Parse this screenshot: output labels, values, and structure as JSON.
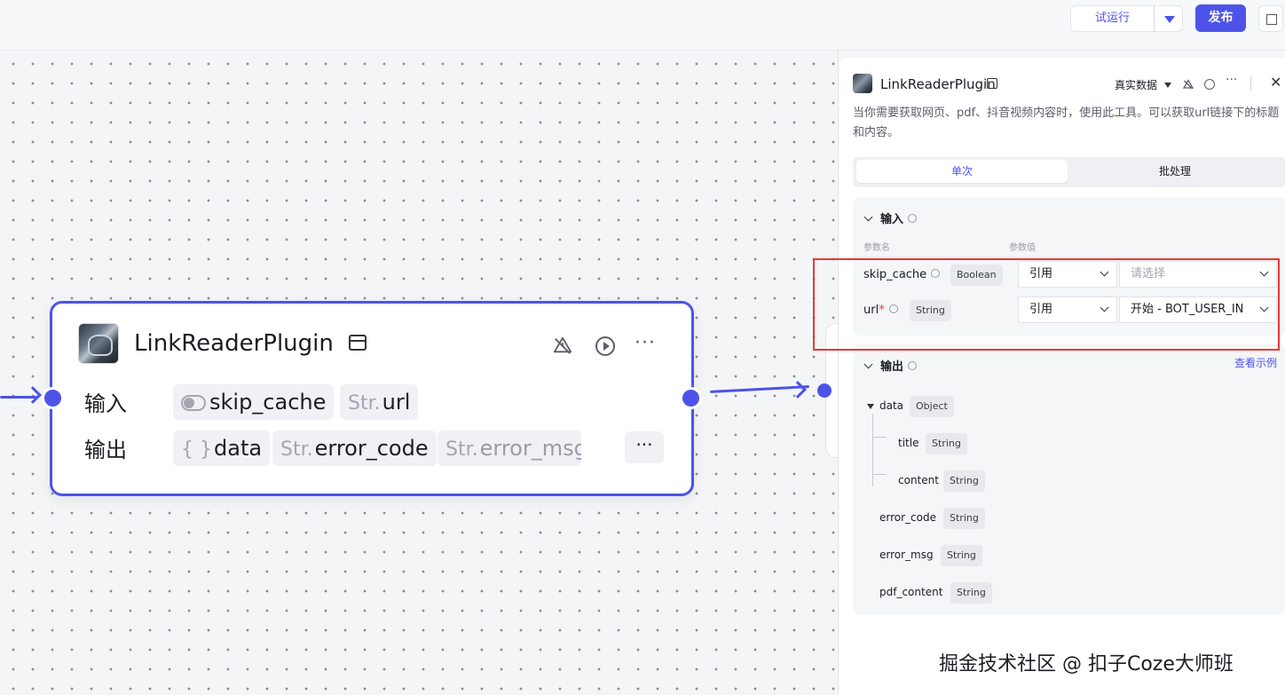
{
  "toolbar": {
    "trial_run_label": "试运行",
    "publish_label": "发布"
  },
  "node": {
    "title": "LinkReaderPlugin",
    "input_label": "输入",
    "output_label": "输出",
    "inputs": [
      {
        "prefix": "",
        "name": "skip_cache"
      },
      {
        "prefix": "Str.",
        "name": "url"
      }
    ],
    "outputs": [
      {
        "prefix": "{ }",
        "name": "data"
      },
      {
        "prefix": "Str.",
        "name": "error_code"
      },
      {
        "prefix": "Str.",
        "name": "error_msg"
      }
    ],
    "more_label": "···"
  },
  "panel": {
    "title": "LinkReaderPlugin",
    "data_mode": "真实数据",
    "description": "当你需要获取网页、pdf、抖音视频内容时，使用此工具。可以获取url链接下的标题和内容。",
    "tabs": [
      "单次",
      "批处理"
    ],
    "input_section": {
      "title": "输入",
      "col_name": "参数名",
      "col_value": "参数值",
      "params": [
        {
          "name": "skip_cache",
          "required": false,
          "type": "Boolean",
          "mode": "引用",
          "value": "请选择",
          "placeholder": true
        },
        {
          "name": "url",
          "required": true,
          "type": "String",
          "mode": "引用",
          "value": "开始 - BOT_USER_IN",
          "placeholder": false
        }
      ]
    },
    "output_section": {
      "title": "输出",
      "view_example": "查看示例",
      "fields": [
        {
          "name": "data",
          "type": "Object"
        },
        {
          "name": "title",
          "type": "String"
        },
        {
          "name": "content",
          "type": "String"
        },
        {
          "name": "error_code",
          "type": "String"
        },
        {
          "name": "error_msg",
          "type": "String"
        },
        {
          "name": "pdf_content",
          "type": "String"
        }
      ]
    }
  },
  "watermark": "掘金技术社区 @ 扣子Coze大师班",
  "colors": {
    "accent": "#4d53e8",
    "highlight_box": "#e53935"
  }
}
